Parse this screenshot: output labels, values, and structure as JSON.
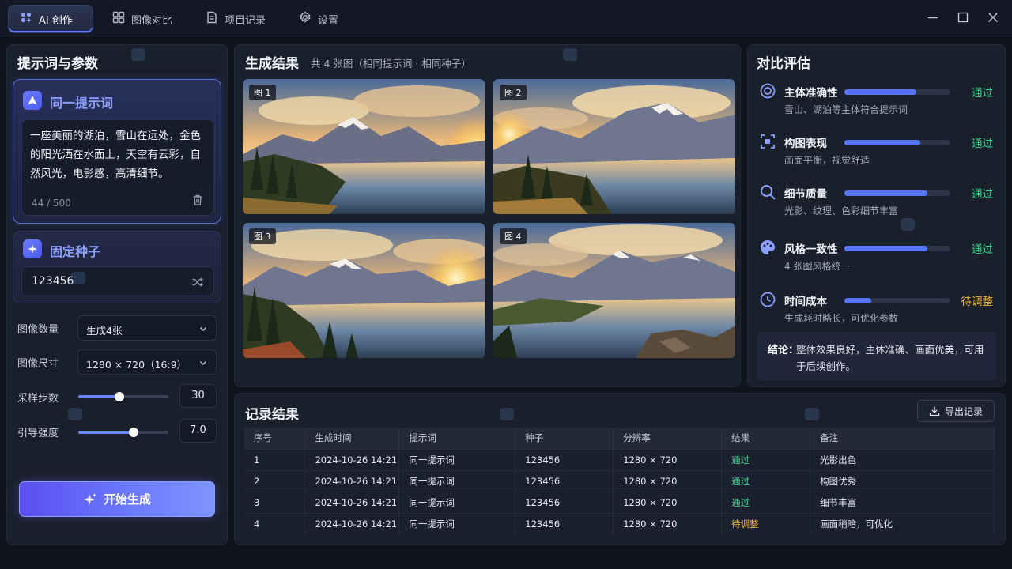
{
  "tabs": [
    {
      "label": "AI 创作",
      "icon": "sparkles-grid-icon",
      "active": true
    },
    {
      "label": "图像对比",
      "icon": "compare-grid-icon",
      "active": false
    },
    {
      "label": "项目记录",
      "icon": "document-icon",
      "active": false
    },
    {
      "label": "设置",
      "icon": "gear-icon",
      "active": false
    }
  ],
  "window_controls": [
    "minimize-icon",
    "maximize-icon",
    "close-icon"
  ],
  "left": {
    "title": "提示词与参数",
    "prompt_card": {
      "title": "同一提示词",
      "text": "一座美丽的湖泊，雪山在远处，金色的阳光洒在水面上，天空有云彩，自然风光，电影感，高清细节。",
      "counter": "44 / 500"
    },
    "seed_card": {
      "title": "固定种子",
      "value": "123456"
    },
    "params": {
      "count_label": "图像数量",
      "count_value": "生成4张",
      "size_label": "图像尺寸",
      "size_value": "1280 × 720（16:9）",
      "steps_label": "采样步数",
      "steps_value": "30",
      "steps_fraction": 0.46,
      "guidance_label": "引导强度",
      "guidance_value": "7.0",
      "guidance_fraction": 0.61
    },
    "generate_label": "开始生成"
  },
  "middle": {
    "title": "生成结果",
    "subtitle": "共 4 张图（相同提示词 · 相同种子）",
    "images": [
      {
        "label": "图 1"
      },
      {
        "label": "图 2"
      },
      {
        "label": "图 3"
      },
      {
        "label": "图 4"
      }
    ]
  },
  "right": {
    "title": "对比评估",
    "items": [
      {
        "name": "主体准确性",
        "desc": "雪山、湖泊等主体符合提示词",
        "status": "通过",
        "score": 0.68,
        "icon": "target-icon"
      },
      {
        "name": "构图表现",
        "desc": "画面平衡，视觉舒适",
        "status": "通过",
        "score": 0.72,
        "icon": "frame-focus-icon"
      },
      {
        "name": "细节质量",
        "desc": "光影、纹理、色彩细节丰富",
        "status": "通过",
        "score": 0.78,
        "icon": "magnifier-icon"
      },
      {
        "name": "风格一致性",
        "desc": "4 张图风格统一",
        "status": "通过",
        "score": 0.78,
        "icon": "palette-icon"
      },
      {
        "name": "时间成本",
        "desc": "生成耗时略长，可优化参数",
        "status": "待调整",
        "score": 0.25,
        "icon": "clock-icon"
      }
    ],
    "conclusion_label": "结论：",
    "conclusion_text": "整体效果良好，主体准确、画面优美，可用于后续创作。"
  },
  "records": {
    "title": "记录结果",
    "export_label": "导出记录",
    "columns": [
      "序号",
      "生成时间",
      "提示词",
      "种子",
      "分辨率",
      "结果",
      "备注"
    ],
    "rows": [
      [
        "1",
        "2024-10-26 14:21",
        "同一提示词",
        "123456",
        "1280 × 720",
        "通过",
        "光影出色"
      ],
      [
        "2",
        "2024-10-26 14:21",
        "同一提示词",
        "123456",
        "1280 × 720",
        "通过",
        "构图优秀"
      ],
      [
        "3",
        "2024-10-26 14:21",
        "同一提示词",
        "123456",
        "1280 × 720",
        "通过",
        "细节丰富"
      ],
      [
        "4",
        "2024-10-26 14:21",
        "同一提示词",
        "123456",
        "1280 × 720",
        "待调整",
        "画面稍暗，可优化"
      ]
    ]
  },
  "colors": {
    "accent": "#5676ff",
    "pass": "#3ad68a",
    "adjust": "#f2b43a"
  }
}
